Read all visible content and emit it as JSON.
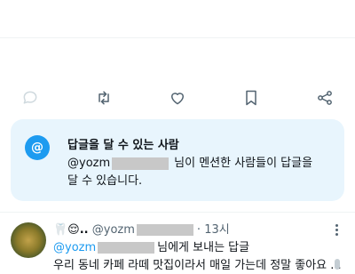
{
  "colors": {
    "accent": "#1d9bf0",
    "secondary_text": "#536471",
    "card_bg": "#e8f5fd"
  },
  "actions": [
    {
      "icon": "reply-icon",
      "enabled": false
    },
    {
      "icon": "retweet-icon",
      "enabled": true
    },
    {
      "icon": "like-icon",
      "enabled": true
    },
    {
      "icon": "bookmark-icon",
      "enabled": true
    },
    {
      "icon": "share-icon",
      "enabled": true
    }
  ],
  "reply_restriction": {
    "badge": "@",
    "title": "답글을 달 수 있는 사람",
    "handle": "@yozm",
    "message_after": "님이 멘션한 사람들이 답글을",
    "message_line2": "달 수 있습니다."
  },
  "reply": {
    "prefix_emoji": "🦷😌..",
    "handle": "@yozm",
    "separator": "·",
    "time": "13시",
    "reply_to_handle": "@yozm",
    "reply_to_suffix": "님에게 보내는 답글",
    "text_partial": "우리 동네 카페 라떼 맛집이라서 매일 가는데 정말 좋아요 ..."
  }
}
